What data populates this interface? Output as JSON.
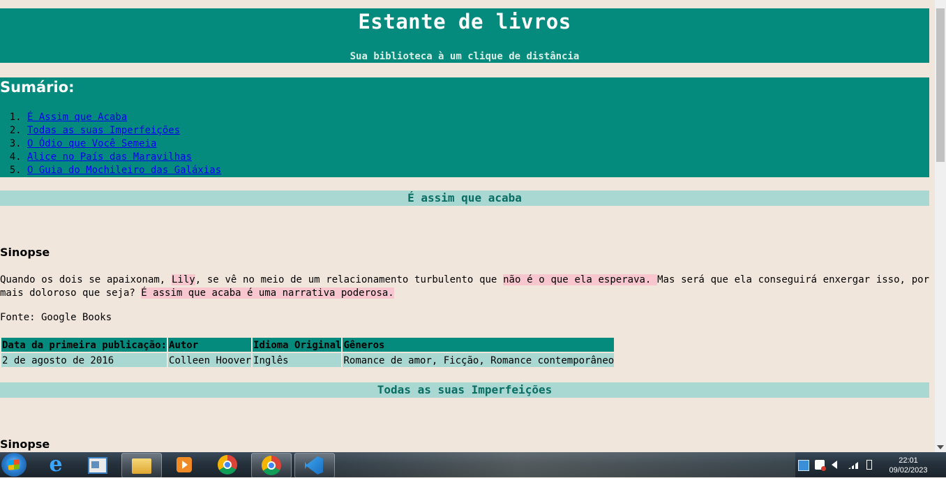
{
  "header": {
    "title": "Estante de livros",
    "subtitle": "Sua biblioteca à um clique de distância"
  },
  "summary": {
    "title": "Sumário:",
    "items": [
      "É Assim que Acaba",
      "Todas as suas Imperfeições",
      "O Ódio que Você Semeia",
      "Alice no País das Maravilhas",
      "O Guia do Mochileiro das Galáxias"
    ]
  },
  "book1": {
    "heading": "É assim que acaba",
    "synopsis_label": "Sinopse",
    "synopsis_parts": [
      "Quando os dois se apaixonam, ",
      "Lily",
      ", se vê no meio de um relacionamento turbulento que ",
      "não é o que ela esperava. ",
      "Mas será que ela conseguirá enxergar isso, por mais doloroso que seja? ",
      "É assim que acaba é uma narrativa poderosa."
    ],
    "source": "Fonte: Google Books",
    "table": {
      "headers": [
        "Data da primeira publicação:",
        "Autor",
        "Idioma Original",
        "Gêneros"
      ],
      "row": [
        "2 de agosto de 2016",
        "Colleen Hoover",
        "Inglês",
        "Romance de amor, Ficção, Romance contemporâneo"
      ]
    }
  },
  "book2": {
    "heading": "Todas as suas Imperfeições",
    "synopsis_label": "Sinopse"
  },
  "taskbar": {
    "time": "22:01",
    "date": "09/02/2023",
    "icons": [
      "start-orb",
      "internet-explorer-icon",
      "task-manager-icon",
      "file-explorer-icon",
      "media-player-icon",
      "chrome-icon",
      "chrome-profile-icon",
      "vscode-icon"
    ]
  },
  "colors": {
    "page_bg": "#f1e6dc",
    "teal": "#058b7e",
    "light_teal": "#a8d8d1",
    "highlight": "#f7c6cf",
    "link": "#0000ee"
  }
}
